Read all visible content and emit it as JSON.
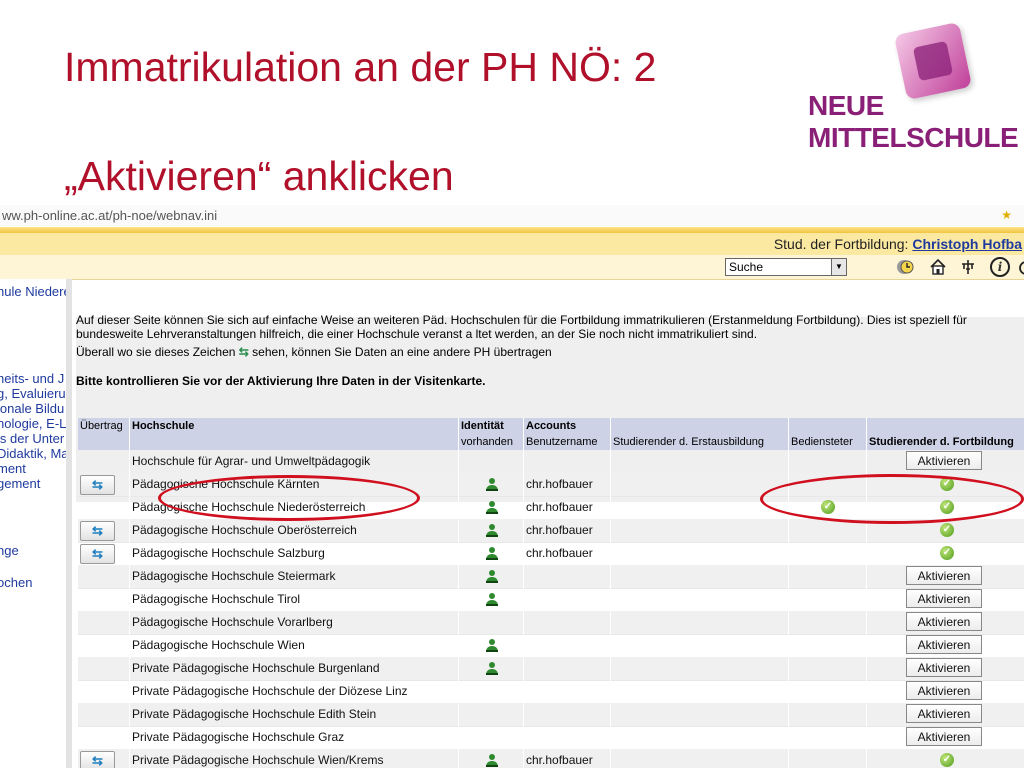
{
  "slide": {
    "title": "Immatrikulation an der PH NÖ: 2",
    "subtitle": "„Aktivieren“ anklicken",
    "logo": {
      "line1": "NEUE",
      "line2": "MITTELSCHULE",
      "color": "#8a1f77"
    }
  },
  "browser": {
    "url": "ww.ph-online.ac.at/ph-noe/webnav.ini",
    "user_prefix": "Stud. der Fortbildung:",
    "user_name": "Christoph Hofba",
    "search_select": "Suche",
    "icons": [
      "clock-icon",
      "home-icon",
      "tree-icon",
      "info-icon",
      "power-icon"
    ]
  },
  "sidebar": {
    "items": [
      "hule Niedere",
      "heits- und J",
      "g, Evaluieru",
      "ionale Bildu",
      "nologie, E-Le",
      "is der Unter",
      "Didaktik, Ma",
      "ment",
      "gement",
      "nge",
      "ochen"
    ]
  },
  "info": {
    "line1": "Auf dieser Seite können Sie sich auf einfache Weise an weiteren Päd. Hochschulen für die Fortbildung immatrikulieren (Erstanmeldung Fortbildung). Dies ist speziell für",
    "line2": "bundesweite Lehrveranstaltungen hilfreich, die einer Hochschule veranst a ltet werden, an der Sie noch nicht immatrikuliert sind.",
    "line3_pre": "Überall wo sie dieses Zeichen",
    "line3_post": "sehen, können Sie Daten an eine andere PH übertragen",
    "bold_line": "Bitte kontrollieren Sie vor der Aktivierung Ihre Daten in der Visitenkarte."
  },
  "table": {
    "headers_top": {
      "transfer": "Übertrag",
      "school": "Hochschule",
      "identity": "Identität",
      "accounts": "Accounts"
    },
    "headers_sub": {
      "identity": "vorhanden",
      "username": "Benutzername",
      "initial": "Studierender d. Erstausbildung",
      "staff": "Bediensteter",
      "cpd": "Studierender d. Fortbildung"
    },
    "activate_label": "Aktivieren",
    "rows": [
      {
        "school": "Hochschule für Agrar- und Umweltpädagogik",
        "transfer": false,
        "identity": false,
        "username": "",
        "staff": false,
        "cpd": "button"
      },
      {
        "school": "Pädagogische Hochschule Kärnten",
        "transfer": true,
        "identity": true,
        "username": "chr.hofbauer",
        "staff": false,
        "cpd": "check"
      },
      {
        "school": "Pädagogische Hochschule Niederösterreich",
        "transfer": false,
        "identity": true,
        "username": "chr.hofbauer",
        "staff": true,
        "cpd": "check"
      },
      {
        "school": "Pädagogische Hochschule Oberösterreich",
        "transfer": true,
        "identity": true,
        "username": "chr.hofbauer",
        "staff": false,
        "cpd": "check"
      },
      {
        "school": "Pädagogische Hochschule Salzburg",
        "transfer": true,
        "identity": true,
        "username": "chr.hofbauer",
        "staff": false,
        "cpd": "check"
      },
      {
        "school": "Pädagogische Hochschule Steiermark",
        "transfer": false,
        "identity": true,
        "username": "",
        "staff": false,
        "cpd": "button"
      },
      {
        "school": "Pädagogische Hochschule Tirol",
        "transfer": false,
        "identity": true,
        "username": "",
        "staff": false,
        "cpd": "button"
      },
      {
        "school": "Pädagogische Hochschule Vorarlberg",
        "transfer": false,
        "identity": false,
        "username": "",
        "staff": false,
        "cpd": "button"
      },
      {
        "school": "Pädagogische Hochschule Wien",
        "transfer": false,
        "identity": true,
        "username": "",
        "staff": false,
        "cpd": "button"
      },
      {
        "school": "Private Pädagogische Hochschule Burgenland",
        "transfer": false,
        "identity": true,
        "username": "",
        "staff": false,
        "cpd": "button"
      },
      {
        "school": "Private Pädagogische Hochschule der Diözese Linz",
        "transfer": false,
        "identity": false,
        "username": "",
        "staff": false,
        "cpd": "button"
      },
      {
        "school": "Private Pädagogische Hochschule Edith Stein",
        "transfer": false,
        "identity": false,
        "username": "",
        "staff": false,
        "cpd": "button"
      },
      {
        "school": "Private Pädagogische Hochschule Graz",
        "transfer": false,
        "identity": false,
        "username": "",
        "staff": false,
        "cpd": "button"
      },
      {
        "school": "Private Pädagogische Hochschule Wien/Krems",
        "transfer": true,
        "identity": true,
        "username": "chr.hofbauer",
        "staff": false,
        "cpd": "check"
      }
    ]
  },
  "colors": {
    "title": "#b0102a",
    "annotation": "#d0101f",
    "header_bar": "#fbe9a2",
    "table_header": "#cdd2e6"
  }
}
